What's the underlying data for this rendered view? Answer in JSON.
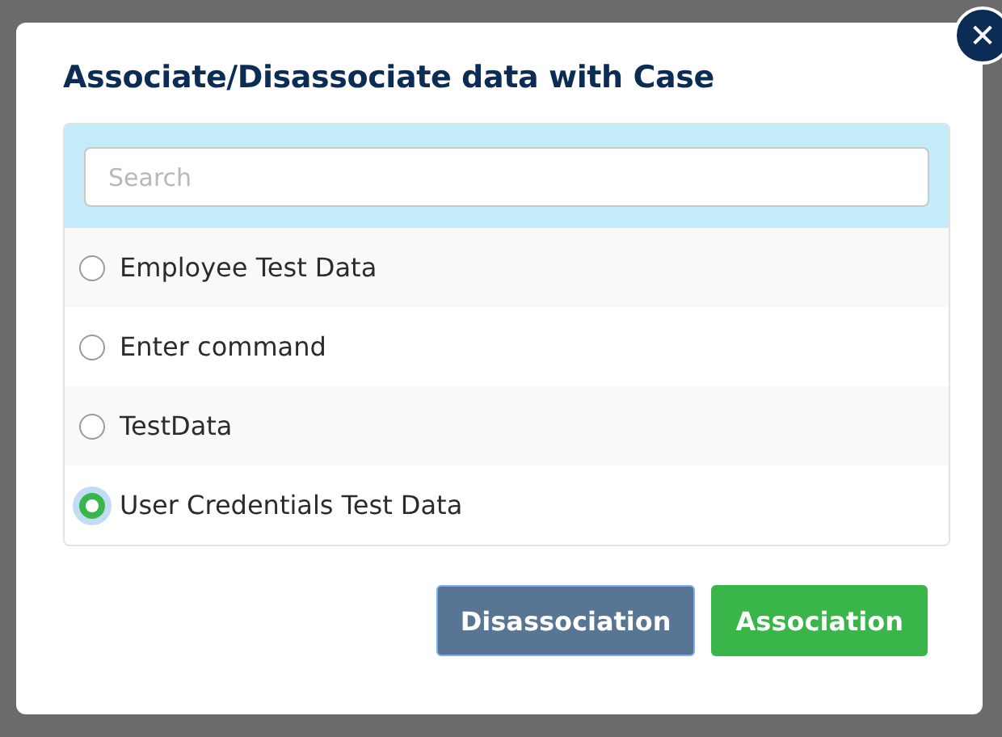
{
  "dialog": {
    "title": "Associate/Disassociate data with Case",
    "close": "✕"
  },
  "search": {
    "placeholder": "Search"
  },
  "items": [
    {
      "label": "Employee Test Data",
      "selected": false
    },
    {
      "label": "Enter command",
      "selected": false
    },
    {
      "label": "TestData",
      "selected": false
    },
    {
      "label": "User Credentials Test Data",
      "selected": true
    }
  ],
  "buttons": [
    {
      "label": "Disassociation",
      "kind": "secondary"
    },
    {
      "label": "Association",
      "kind": "primary"
    }
  ]
}
